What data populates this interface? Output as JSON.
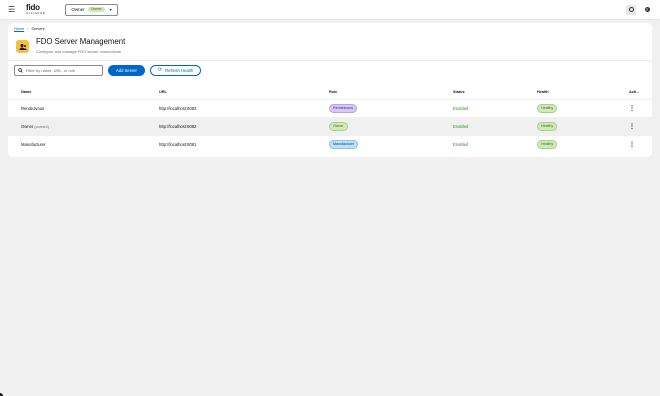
{
  "header": {
    "logo_main": "fido",
    "logo_sub": "ALLIANCE",
    "context": {
      "label": "Owner",
      "badge": "Owner",
      "caret": "▾"
    }
  },
  "breadcrumb": {
    "home": "Home",
    "separator": "›",
    "current": "Servers"
  },
  "page": {
    "title": "FDO Server Management",
    "subtitle": "Configure and manage FDO server connections"
  },
  "toolbar": {
    "search_placeholder": "Filter by name, URL, or role",
    "add_label": "Add Server",
    "refresh_label": "Refresh Health"
  },
  "table": {
    "columns": {
      "name": "Name",
      "url": "URL",
      "role": "Role",
      "status": "Status",
      "health": "Health",
      "actions": "Acti..."
    },
    "rows": [
      {
        "name": "Rendezvous",
        "name_note": "",
        "url": "http://localhost:8083",
        "role": "Rendezvous",
        "status": "Enabled",
        "health": "Healthy"
      },
      {
        "name": "Owner",
        "name_note": "(current)",
        "url": "http://localhost:8082",
        "role": "Owner",
        "status": "Enabled",
        "health": "Healthy"
      },
      {
        "name": "Manufacturer",
        "name_note": "",
        "url": "http://localhost:8081",
        "role": "Manufacturer",
        "status": "Enabled",
        "health": "Healthy"
      }
    ],
    "kebab": "⋮"
  },
  "colors": {
    "primary": "#0066cc",
    "healthy": "#d1e9b9",
    "role_rendezvous": "#d5c8f2",
    "role_manufacturer": "#bee1f4",
    "page_icon": "#f4c145"
  },
  "icons": [
    "hamburger-icon",
    "gear-icon",
    "help-icon",
    "search-icon",
    "refresh-icon",
    "users-icon",
    "kebab-icon"
  ]
}
